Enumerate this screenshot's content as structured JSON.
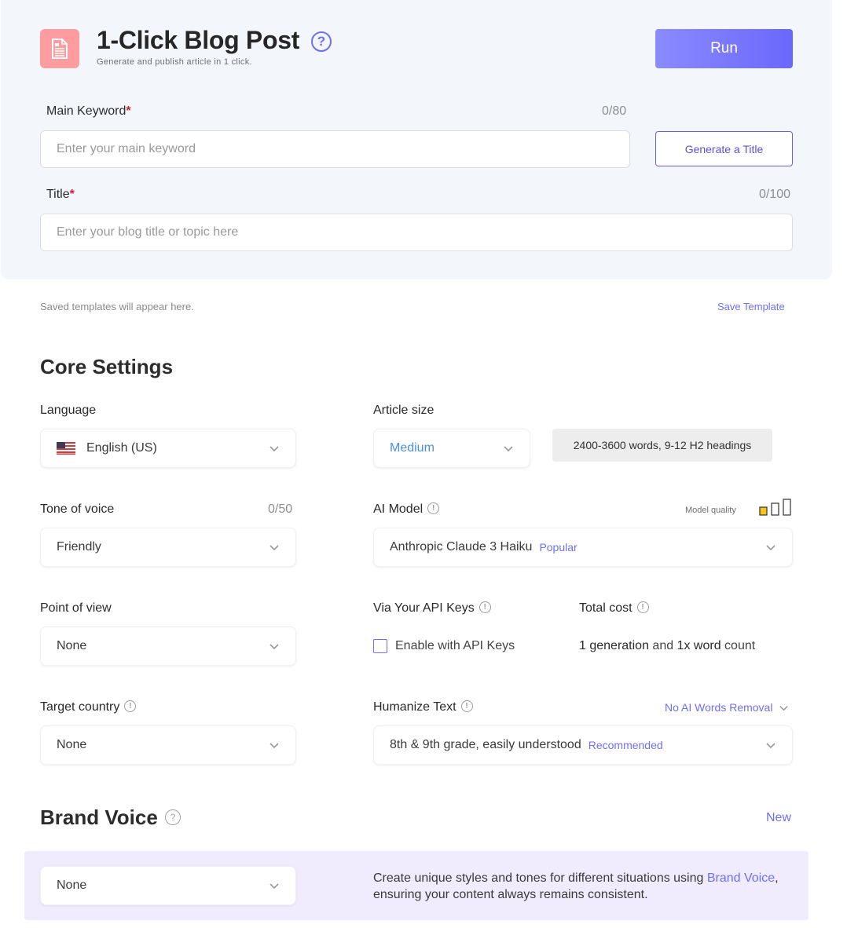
{
  "header": {
    "title": "1-Click Blog Post",
    "subtitle": "Generate and publish article in 1 click.",
    "icon": "document-icon",
    "help_icon": "question-circle-icon",
    "run_label": "Run"
  },
  "main_keyword": {
    "label": "Main Keyword",
    "required_mark": "*",
    "counter": "0/80",
    "placeholder": "Enter your main keyword",
    "value": ""
  },
  "generate_title_label": "Generate a Title",
  "title_field": {
    "label": "Title",
    "required_mark": "*",
    "counter": "0/100",
    "placeholder": "Enter your blog title or topic here",
    "value": ""
  },
  "templates": {
    "hint": "Saved templates will appear here.",
    "save_label": "Save Template"
  },
  "core_settings": {
    "title": "Core Settings",
    "language": {
      "label": "Language",
      "value": "English (US)",
      "flag": "us-flag-icon"
    },
    "article_size": {
      "label": "Article size",
      "value": "Medium",
      "info": "2400-3600 words, 9-12 H2 headings"
    },
    "tone": {
      "label": "Tone of voice",
      "counter": "0/50",
      "value": "Friendly"
    },
    "ai_model": {
      "label": "AI Model",
      "quality_label": "Model quality",
      "quality_level": 1,
      "quality_max": 3,
      "value": "Anthropic Claude 3 Haiku",
      "tag": "Popular"
    },
    "point_of_view": {
      "label": "Point of view",
      "value": "None"
    },
    "api_keys": {
      "label": "Via Your API Keys",
      "checkbox_label": "Enable with API Keys",
      "checked": false
    },
    "total_cost": {
      "label": "Total cost",
      "gen_count": "1 generation",
      "and": " and ",
      "word_mult": "1x word",
      "suffix": " count"
    },
    "target_country": {
      "label": "Target country",
      "value": "None"
    },
    "humanize": {
      "label": "Humanize Text",
      "option_link": "No AI Words Removal",
      "value": "8th & 9th grade, easily understood",
      "tag": "Recommended"
    }
  },
  "brand_voice": {
    "title": "Brand Voice",
    "new_label": "New",
    "value": "None",
    "desc_before": "Create unique styles and tones for different situations using ",
    "desc_link": "Brand Voice",
    "desc_after": ", ensuring your content always remains consistent."
  },
  "colors": {
    "accent": "#6f6ff6",
    "run_gradient_start": "#8a8bff",
    "run_gradient_end": "#6a68fb",
    "app_icon_bg": "#fe9c9f",
    "required": "#d21e2b",
    "quality_fill": "#f5c518",
    "brand_panel_bg": "#f0ebfd",
    "top_panel_bg": "#f3f7fc"
  }
}
